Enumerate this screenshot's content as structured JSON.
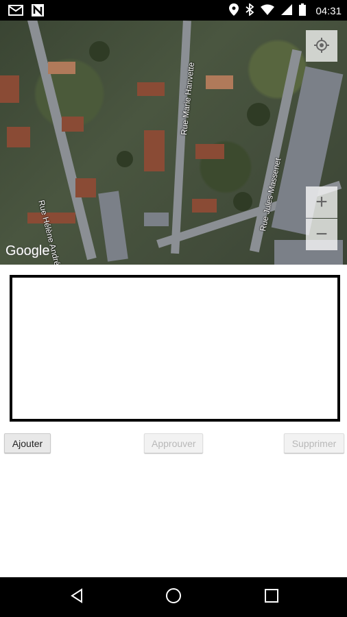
{
  "status_bar": {
    "time": "04:31",
    "left_icons": [
      "mail-icon",
      "n-notification-icon"
    ],
    "right_icons": [
      "location-icon",
      "bluetooth-icon",
      "wifi-icon",
      "cell-signal-icon",
      "battery-icon"
    ]
  },
  "map": {
    "provider_logo": "Google",
    "street_labels": [
      "Rue Hélène Andrée",
      "Rue Marie Hanvette",
      "Rue Jules Massenet"
    ],
    "controls": {
      "locate": "my-location-icon",
      "zoom_in": "+",
      "zoom_out": "−"
    }
  },
  "actions": {
    "add_label": "Ajouter",
    "approve_label": "Approuver",
    "delete_label": "Supprimer"
  },
  "navigation": {
    "icons": [
      "back-icon",
      "home-icon",
      "recents-icon"
    ]
  },
  "colors": {
    "status_bar_bg": "#000000",
    "nav_bar_bg": "#000000",
    "disabled_text": "#b8b8b8"
  }
}
